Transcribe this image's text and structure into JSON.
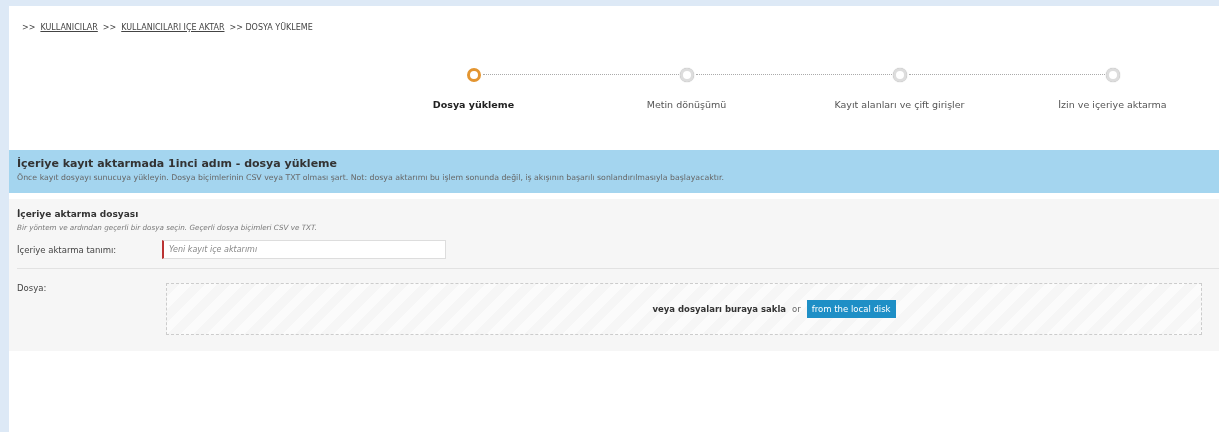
{
  "breadcrumb": [
    {
      "text": ">>",
      "kind": "separator"
    },
    {
      "text": "KULLANICILAR",
      "kind": "link"
    },
    {
      "text": ">>",
      "kind": "separator"
    },
    {
      "text": "KULLANICILARI IÇE AKTAR",
      "kind": "link"
    },
    {
      "text": ">> DOSYA YÜKLEME",
      "kind": "current"
    }
  ],
  "steps": [
    {
      "label": "Dosya yükleme",
      "selected": true
    },
    {
      "label": "Metin dönüşümü",
      "selected": false
    },
    {
      "label": "Kayıt alanları ve çift girişler",
      "selected": false
    },
    {
      "label": "İzin ve içeriye aktarma",
      "selected": false
    }
  ],
  "banner": {
    "title": "İçeriye kayıt aktarmada 1inci adım - dosya yükleme",
    "text": "Önce kayıt dosyayı sunucuya yükleyin. Dosya biçimlerinin CSV veya TXT olması şart. Not: dosya aktarımı bu işlem sonunda değil, iş akışının başarılı sonlandırılmasıyla başlayacaktır."
  },
  "section": {
    "title": "İçeriye aktarma dosyası",
    "hint": "Bir yöntem ve ardından geçerli bir dosya seçin. Geçerli dosya biçimleri CSV ve TXT.",
    "name_field": {
      "label": "İçeriye aktarma tanımı:",
      "placeholder": "Yeni kayıt içe aktarımı"
    },
    "file_field": {
      "label": "Dosya:",
      "drop_text": "veya dosyaları buraya sakla",
      "or_text": "or",
      "button": "from the local disk"
    }
  }
}
